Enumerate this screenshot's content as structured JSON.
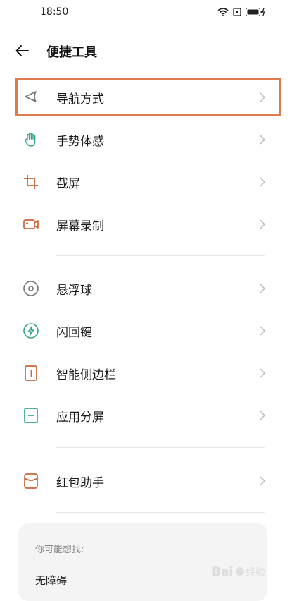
{
  "status_bar": {
    "time": "18:50"
  },
  "header": {
    "title": "便捷工具"
  },
  "groups": [
    {
      "items": [
        {
          "label": "导航方式",
          "icon": "navigation-arrow-icon",
          "highlighted": true
        },
        {
          "label": "手势体感",
          "icon": "hand-gesture-icon"
        },
        {
          "label": "截屏",
          "icon": "crop-screenshot-icon"
        },
        {
          "label": "屏幕录制",
          "icon": "screen-record-icon"
        }
      ]
    },
    {
      "items": [
        {
          "label": "悬浮球",
          "icon": "floating-ball-icon"
        },
        {
          "label": "闪回键",
          "icon": "flashback-key-icon"
        },
        {
          "label": "智能侧边栏",
          "icon": "smart-sidebar-icon"
        },
        {
          "label": "应用分屏",
          "icon": "split-screen-icon"
        }
      ]
    },
    {
      "items": [
        {
          "label": "红包助手",
          "icon": "red-envelope-icon"
        }
      ]
    }
  ],
  "suggestions": {
    "title": "你可能想找:",
    "items": [
      "无障碍"
    ]
  },
  "colors": {
    "highlight_border": "#e07a4f",
    "icon_green": "#3aa58a",
    "icon_orange": "#c8663b",
    "icon_gray": "#777777"
  }
}
